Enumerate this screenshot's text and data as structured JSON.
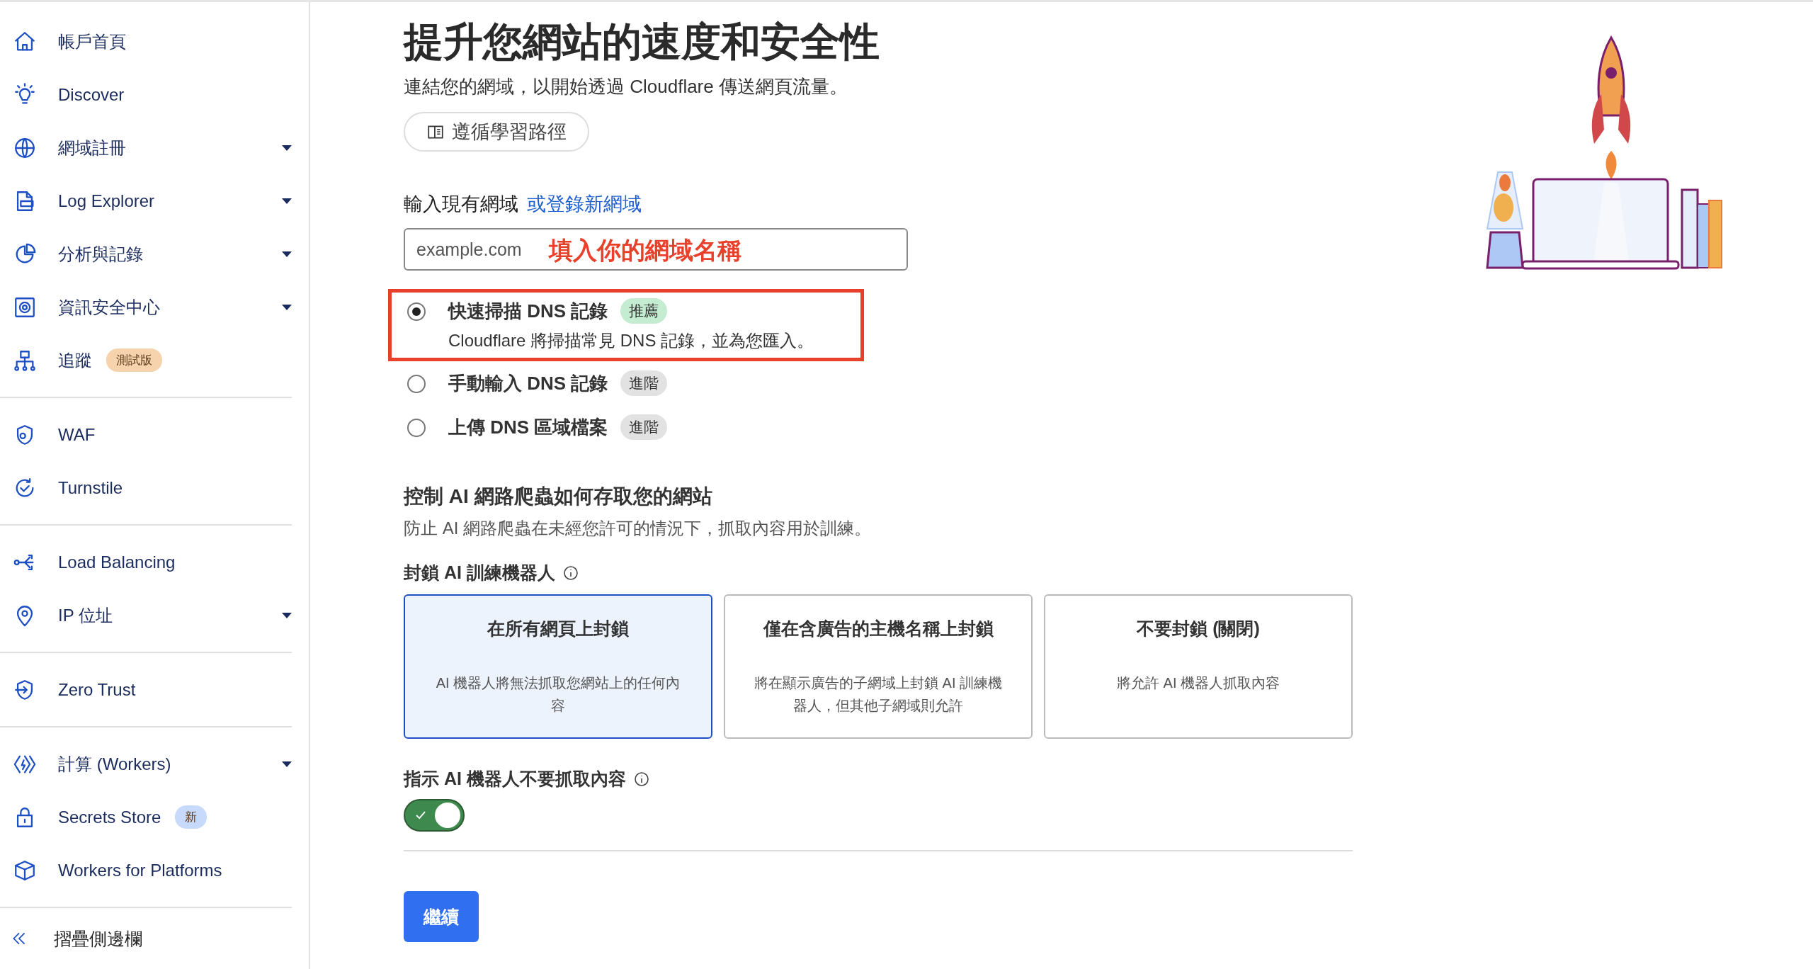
{
  "sidebar": {
    "groups": [
      {
        "items": [
          {
            "label": "帳戶首頁",
            "dropdown": false
          },
          {
            "label": "Discover",
            "dropdown": false
          },
          {
            "label": "網域註冊",
            "dropdown": true
          },
          {
            "label": "Log Explorer",
            "dropdown": true
          },
          {
            "label": "分析與記錄",
            "dropdown": true
          },
          {
            "label": "資訊安全中心",
            "dropdown": true
          },
          {
            "label": "追蹤",
            "dropdown": false,
            "badge": {
              "text": "測試版",
              "color": "#f6d3ad"
            }
          }
        ]
      },
      {
        "items": [
          {
            "label": "WAF",
            "dropdown": false
          },
          {
            "label": "Turnstile",
            "dropdown": false
          }
        ]
      },
      {
        "items": [
          {
            "label": "Load Balancing",
            "dropdown": false
          },
          {
            "label": "IP 位址",
            "dropdown": true
          }
        ]
      },
      {
        "items": [
          {
            "label": "Zero Trust",
            "dropdown": false
          }
        ]
      },
      {
        "items": [
          {
            "label": "計算 (Workers)",
            "dropdown": true
          },
          {
            "label": "Secrets Store",
            "dropdown": false,
            "badge": {
              "text": "新",
              "color": "#c8dafb"
            }
          },
          {
            "label": "Workers for Platforms",
            "dropdown": false
          }
        ]
      }
    ],
    "collapse": "摺疊側邊欄"
  },
  "main": {
    "title": "提升您網站的速度和安全性",
    "subtitle": "連結您的網域，以開始透過 Cloudflare 傳送網頁流量。",
    "learn_button": "遵循學習路徑",
    "domain_label": "輸入現有網域",
    "register_link": "或登錄新網域",
    "domain_field": {
      "placeholder": "example.com"
    },
    "annotation": "填入你的網域名稱",
    "options": [
      {
        "label": "快速掃描 DNS 記錄",
        "tag": {
          "text": "推薦",
          "color": "#c4ecd0"
        },
        "description": "Cloudflare 將掃描常見 DNS 記錄，並為您匯入。",
        "selected": true,
        "highlighted": true
      },
      {
        "label": "手動輸入 DNS 記錄",
        "tag": {
          "text": "進階",
          "color": "#e2e2e2"
        },
        "selected": false,
        "highlighted": false
      },
      {
        "label": "上傳 DNS 區域檔案",
        "tag": {
          "text": "進階",
          "color": "#e2e2e2"
        },
        "selected": false,
        "highlighted": false
      }
    ],
    "ai_section": {
      "title": "控制 AI 網路爬蟲如何存取您的網站",
      "description": "防止 AI 網路爬蟲在未經您許可的情況下，抓取內容用於訓練。",
      "block_label": "封鎖 AI 訓練機器人",
      "cards": [
        {
          "title": "在所有網頁上封鎖",
          "text": "AI 機器人將無法抓取您網站上的任何內容",
          "selected": true
        },
        {
          "title": "僅在含廣告的主機名稱上封鎖",
          "text": "將在顯示廣告的子網域上封鎖 AI 訓練機器人，但其他子網域則允許",
          "selected": false
        },
        {
          "title": "不要封鎖 (關閉)",
          "text": "將允許 AI 機器人抓取內容",
          "selected": false
        }
      ],
      "instruct_label": "指示 AI 機器人不要抓取內容",
      "instruct_on": true
    },
    "continue_button": "繼續"
  }
}
